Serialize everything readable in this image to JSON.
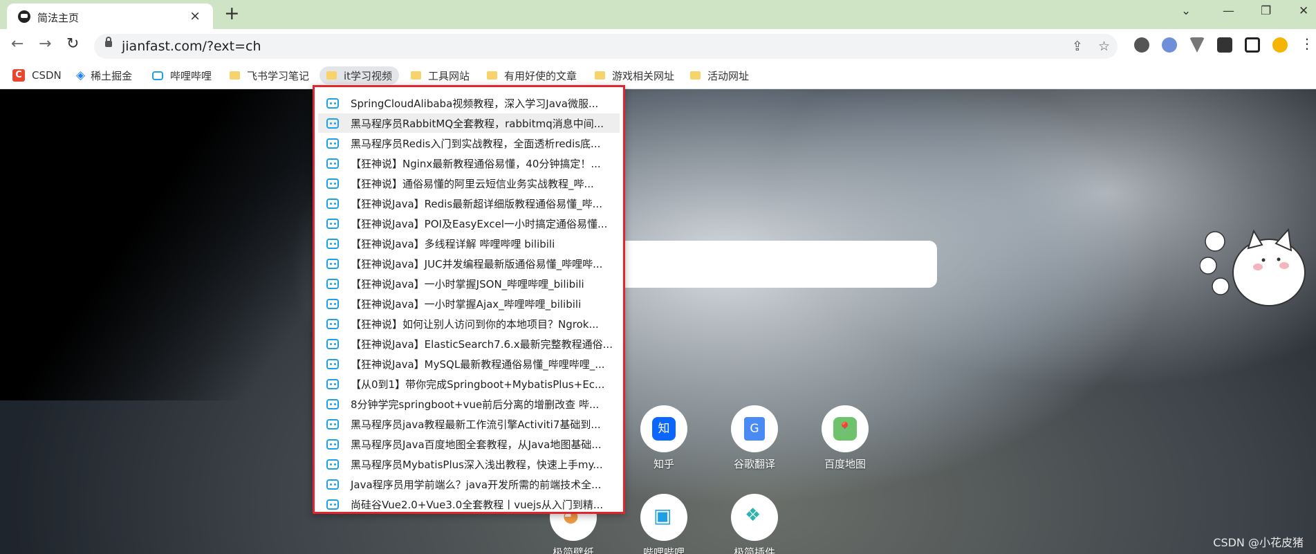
{
  "tab": {
    "title": "简法主页",
    "close_icon": "×",
    "new_tab": "+"
  },
  "window_controls": {
    "dropdown": "⌄",
    "minimize": "—",
    "restore": "❐",
    "close": "✕"
  },
  "nav": {
    "back": "←",
    "forward": "→",
    "reload": "↻"
  },
  "address": {
    "url": "jianfast.com/?ext=ch",
    "share_icon": "⇪",
    "star_icon": "☆"
  },
  "bookmarks": [
    {
      "label": "CSDN",
      "icon": "csdn-icon"
    },
    {
      "label": "稀土掘金",
      "icon": "juejin-icon"
    },
    {
      "label": "哔哩哔哩",
      "icon": "bilibili-icon"
    },
    {
      "label": "飞书学习笔记",
      "icon": "folder-icon"
    },
    {
      "label": "it学习视频",
      "icon": "folder-icon",
      "active": true
    },
    {
      "label": "工具网站",
      "icon": "folder-icon"
    },
    {
      "label": "有用好使的文章",
      "icon": "folder-icon"
    },
    {
      "label": "游戏相关网址",
      "icon": "folder-icon"
    },
    {
      "label": "活动网址",
      "icon": "folder-icon"
    }
  ],
  "dropdown": {
    "items": [
      "SpringCloudAlibaba视频教程，深入学习Java微服...",
      "黑马程序员RabbitMQ全套教程，rabbitmq消息中间...",
      "黑马程序员Redis入门到实战教程，全面透析redis底...",
      "【狂神说】Nginx最新教程通俗易懂，40分钟搞定！...",
      "【狂神说】通俗易懂的阿里云短信业务实战教程_哔...",
      "【狂神说Java】Redis最新超详细版教程通俗易懂_哔...",
      "【狂神说Java】POI及EasyExcel一小时搞定通俗易懂...",
      "【狂神说Java】多线程详解 哔哩哔哩 bilibili",
      "【狂神说Java】JUC并发编程最新版通俗易懂_哔哩哔...",
      "【狂神说Java】一小时掌握JSON_哔哩哔哩_bilibili",
      "【狂神说Java】一小时掌握Ajax_哔哩哔哩_bilibili",
      "【狂神说】如何让别人访问到你的本地项目？Ngrok...",
      "【狂神说Java】ElasticSearch7.6.x最新完整教程通俗...",
      "【狂神说Java】MySQL最新教程通俗易懂_哔哩哔哩_...",
      "【从0到1】带你完成Springboot+MybatisPlus+Ec...",
      "8分钟学完springboot+vue前后分离的增删改查 哔...",
      "黑马程序员java教程最新工作流引擎Activiti7基础到...",
      "黑马程序员Java百度地图全套教程，从Java地图基础...",
      "黑马程序员MybatisPlus深入浅出教程，快速上手my...",
      "Java程序员用学前端么？java开发所需的前端技术全...",
      "尚硅谷Vue2.0+Vue3.0全套教程丨vuejs从入门到精..."
    ],
    "hover_index": 1
  },
  "shortcuts": [
    {
      "label": "知乎",
      "icon": "zhihu-icon",
      "glyph": "知"
    },
    {
      "label": "谷歌翻译",
      "icon": "google-translate-icon",
      "glyph": "G"
    },
    {
      "label": "百度地图",
      "icon": "baidu-map-icon",
      "glyph": "📍"
    },
    {
      "label": "极简壁纸",
      "icon": "wallpaper-icon",
      "glyph": "◕"
    },
    {
      "label": "哔哩哔哩",
      "icon": "bilibili-icon",
      "glyph": "▣"
    },
    {
      "label": "极简插件",
      "icon": "plugin-icon",
      "glyph": "❖"
    }
  ],
  "watermark": "CSDN @小花皮猪",
  "colors": {
    "tabstrip": "#cfe4c4",
    "highlight_border": "#e0252e",
    "bilibili": "#1ea0e8"
  }
}
